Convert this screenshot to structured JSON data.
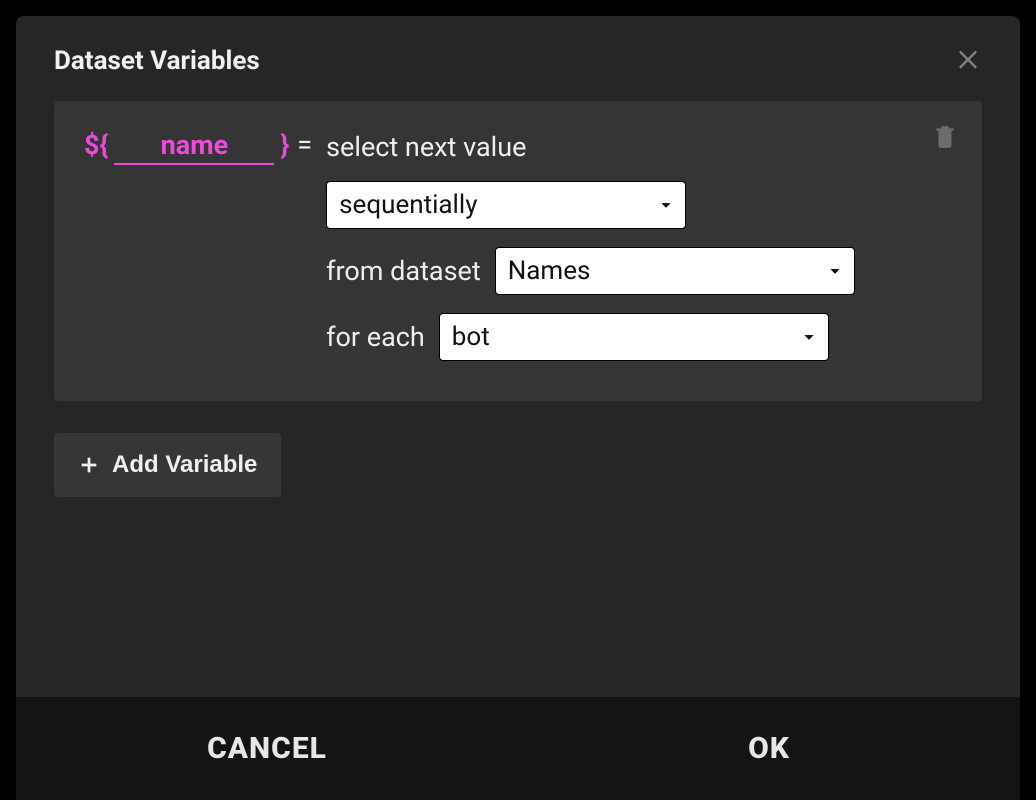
{
  "modal": {
    "title": "Dataset Variables"
  },
  "variable": {
    "name": "name",
    "select_label": "select next value",
    "mode": "sequentially",
    "from_label": "from dataset",
    "dataset": "Names",
    "foreach_label": "for each",
    "foreach": "bot"
  },
  "buttons": {
    "add_variable": "Add Variable",
    "cancel": "CANCEL",
    "ok": "OK"
  }
}
